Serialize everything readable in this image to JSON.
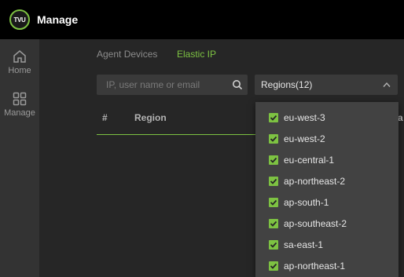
{
  "header": {
    "logo_text": "TVU",
    "title": "Manage"
  },
  "sidebar": {
    "items": [
      {
        "label": "Home",
        "icon": "home-icon"
      },
      {
        "label": "Manage",
        "icon": "grid-icon"
      }
    ]
  },
  "tabs": [
    {
      "label": "Agent Devices",
      "active": false
    },
    {
      "label": "Elastic IP",
      "active": true
    }
  ],
  "search": {
    "placeholder": "IP, user name or email",
    "value": "",
    "icon": "search-icon"
  },
  "regions": {
    "label": "Regions(12)",
    "options": [
      {
        "label": "eu-west-3",
        "checked": true
      },
      {
        "label": "eu-west-2",
        "checked": true
      },
      {
        "label": "eu-central-1",
        "checked": true
      },
      {
        "label": "ap-northeast-2",
        "checked": true
      },
      {
        "label": "ap-south-1",
        "checked": true
      },
      {
        "label": "ap-southeast-2",
        "checked": true
      },
      {
        "label": "sa-east-1",
        "checked": true
      },
      {
        "label": "ap-northeast-1",
        "checked": true
      }
    ]
  },
  "table": {
    "headers": [
      "#",
      "Region",
      "a"
    ]
  },
  "colors": {
    "accent": "#7dc242",
    "topbar": "#000000",
    "sidebar": "#333333",
    "content": "#262626",
    "dropdown": "#424242"
  }
}
